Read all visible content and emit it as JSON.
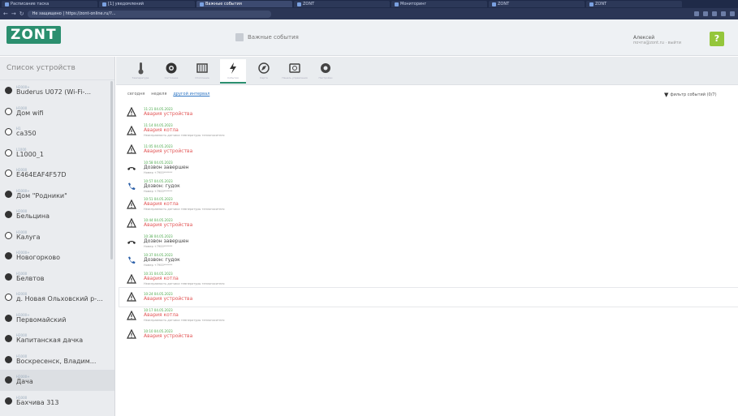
{
  "browser": {
    "tabs": [
      "Расписание таска",
      "[1] уведомлений",
      "Важные события",
      "ZONT",
      "Мониторинг",
      "ZONT",
      "ZONT"
    ],
    "url": "Не защищено | https://zont-online.ru/?..."
  },
  "header": {
    "logo": "ZONT",
    "page_title": "Важные события",
    "user_name": "Алексей",
    "user_sub": "почта@zont.ru · выйти",
    "help": "?"
  },
  "sidebar": {
    "title": "Список устройств",
    "devices": [
      {
        "name": "Buderus U072 (Wi-Fi-...",
        "status": "online",
        "meta": "H2000+",
        "selected": false
      },
      {
        "name": "Дом wifi",
        "status": "offline",
        "meta": "H1000",
        "selected": false
      },
      {
        "name": "ca350",
        "status": "offline",
        "meta": "H1",
        "selected": false
      },
      {
        "name": "L1000_1",
        "status": "offline",
        "meta": "L1000",
        "selected": false
      },
      {
        "name": "E464EAF4F57D",
        "status": "offline",
        "meta": "H2000",
        "selected": false
      },
      {
        "name": "Дом \"Родники\"",
        "status": "online",
        "meta": "H1000+",
        "selected": false
      },
      {
        "name": "Бельцина",
        "status": "online",
        "meta": "H2000",
        "selected": false
      },
      {
        "name": "Калуга",
        "status": "offline",
        "meta": "H1000",
        "selected": false
      },
      {
        "name": "Новогорково",
        "status": "online",
        "meta": "H2000+",
        "selected": false
      },
      {
        "name": "Белвтов",
        "status": "online",
        "meta": "H1000",
        "selected": false
      },
      {
        "name": "д. Новая Ольховский р-...",
        "status": "offline",
        "meta": "H2000",
        "selected": false
      },
      {
        "name": "Первомайский",
        "status": "online",
        "meta": "H1000+",
        "selected": false
      },
      {
        "name": "Капитанская дачка",
        "status": "online",
        "meta": "H2000",
        "selected": false
      },
      {
        "name": "Воскресенск, Владим...",
        "status": "online",
        "meta": "H1000",
        "selected": false
      },
      {
        "name": "Дача",
        "status": "online",
        "meta": "H2000+",
        "selected": true
      },
      {
        "name": "Бахчива 313",
        "status": "online",
        "meta": "H1000",
        "selected": false
      }
    ]
  },
  "toolbar": {
    "items": [
      {
        "icon": "thermometer-icon",
        "label": "Температура",
        "active": false
      },
      {
        "icon": "gauge-icon",
        "label": "Состояние",
        "active": false
      },
      {
        "icon": "radiator-icon",
        "label": "Отопление",
        "active": false
      },
      {
        "icon": "lightning-icon",
        "label": "События",
        "active": true
      },
      {
        "icon": "location-icon",
        "label": "Карта",
        "active": false
      },
      {
        "icon": "panel-icon",
        "label": "Панель управления",
        "active": false
      },
      {
        "icon": "settings-icon",
        "label": "Настройки",
        "active": false
      }
    ]
  },
  "filters": {
    "today": "сегодня",
    "week": "неделя",
    "custom": "другой интервал",
    "right": "фильтр событий (0/7)"
  },
  "events": [
    {
      "type": "warning",
      "time": "11:21 04.05.2023",
      "title": "Авария устройства",
      "detail": "",
      "red": true
    },
    {
      "type": "warning",
      "time": "11:14 04.05.2023",
      "title": "Авария котла",
      "detail": "Неисправность датчика температуры теплоносителя",
      "red": true
    },
    {
      "type": "warning",
      "time": "11:05 04.05.2023",
      "title": "Авария устройства",
      "detail": "",
      "red": true
    },
    {
      "type": "hangup",
      "time": "10:58 04.05.2023",
      "title": "Дозвон завершен",
      "detail": "Номер +7900******",
      "red": false
    },
    {
      "type": "phone",
      "time": "10:57 04.05.2023",
      "title": "Дозвон: гудок",
      "detail": "Номер +7900******",
      "red": false
    },
    {
      "type": "warning",
      "time": "10:51 04.05.2023",
      "title": "Авария котла",
      "detail": "Неисправность датчика температуры теплоносителя",
      "red": true
    },
    {
      "type": "warning",
      "time": "10:44 04.05.2023",
      "title": "Авария устройства",
      "detail": "",
      "red": true
    },
    {
      "type": "hangup",
      "time": "10:38 04.05.2023",
      "title": "Дозвон завершен",
      "detail": "Номер +7900******",
      "red": false
    },
    {
      "type": "phone",
      "time": "10:37 04.05.2023",
      "title": "Дозвон: гудок",
      "detail": "Номер +7900******",
      "red": false
    },
    {
      "type": "warning",
      "time": "10:31 04.05.2023",
      "title": "Авария котла",
      "detail": "Неисправность датчика температуры теплоносителя",
      "red": true
    },
    {
      "type": "warning",
      "time": "10:24 04.05.2023",
      "title": "Авария устройства",
      "detail": "",
      "red": true,
      "highlight": true
    },
    {
      "type": "warning",
      "time": "10:17 04.05.2023",
      "title": "Авария котла",
      "detail": "Неисправность датчика температуры теплоносителя",
      "red": true
    },
    {
      "type": "warning",
      "time": "10:10 04.05.2023",
      "title": "Авария устройства",
      "detail": "",
      "red": true
    }
  ],
  "colors": {
    "brand": "#2b8f6f",
    "alert": "#e25555",
    "time": "#4aa84a",
    "help": "#94c63b"
  }
}
